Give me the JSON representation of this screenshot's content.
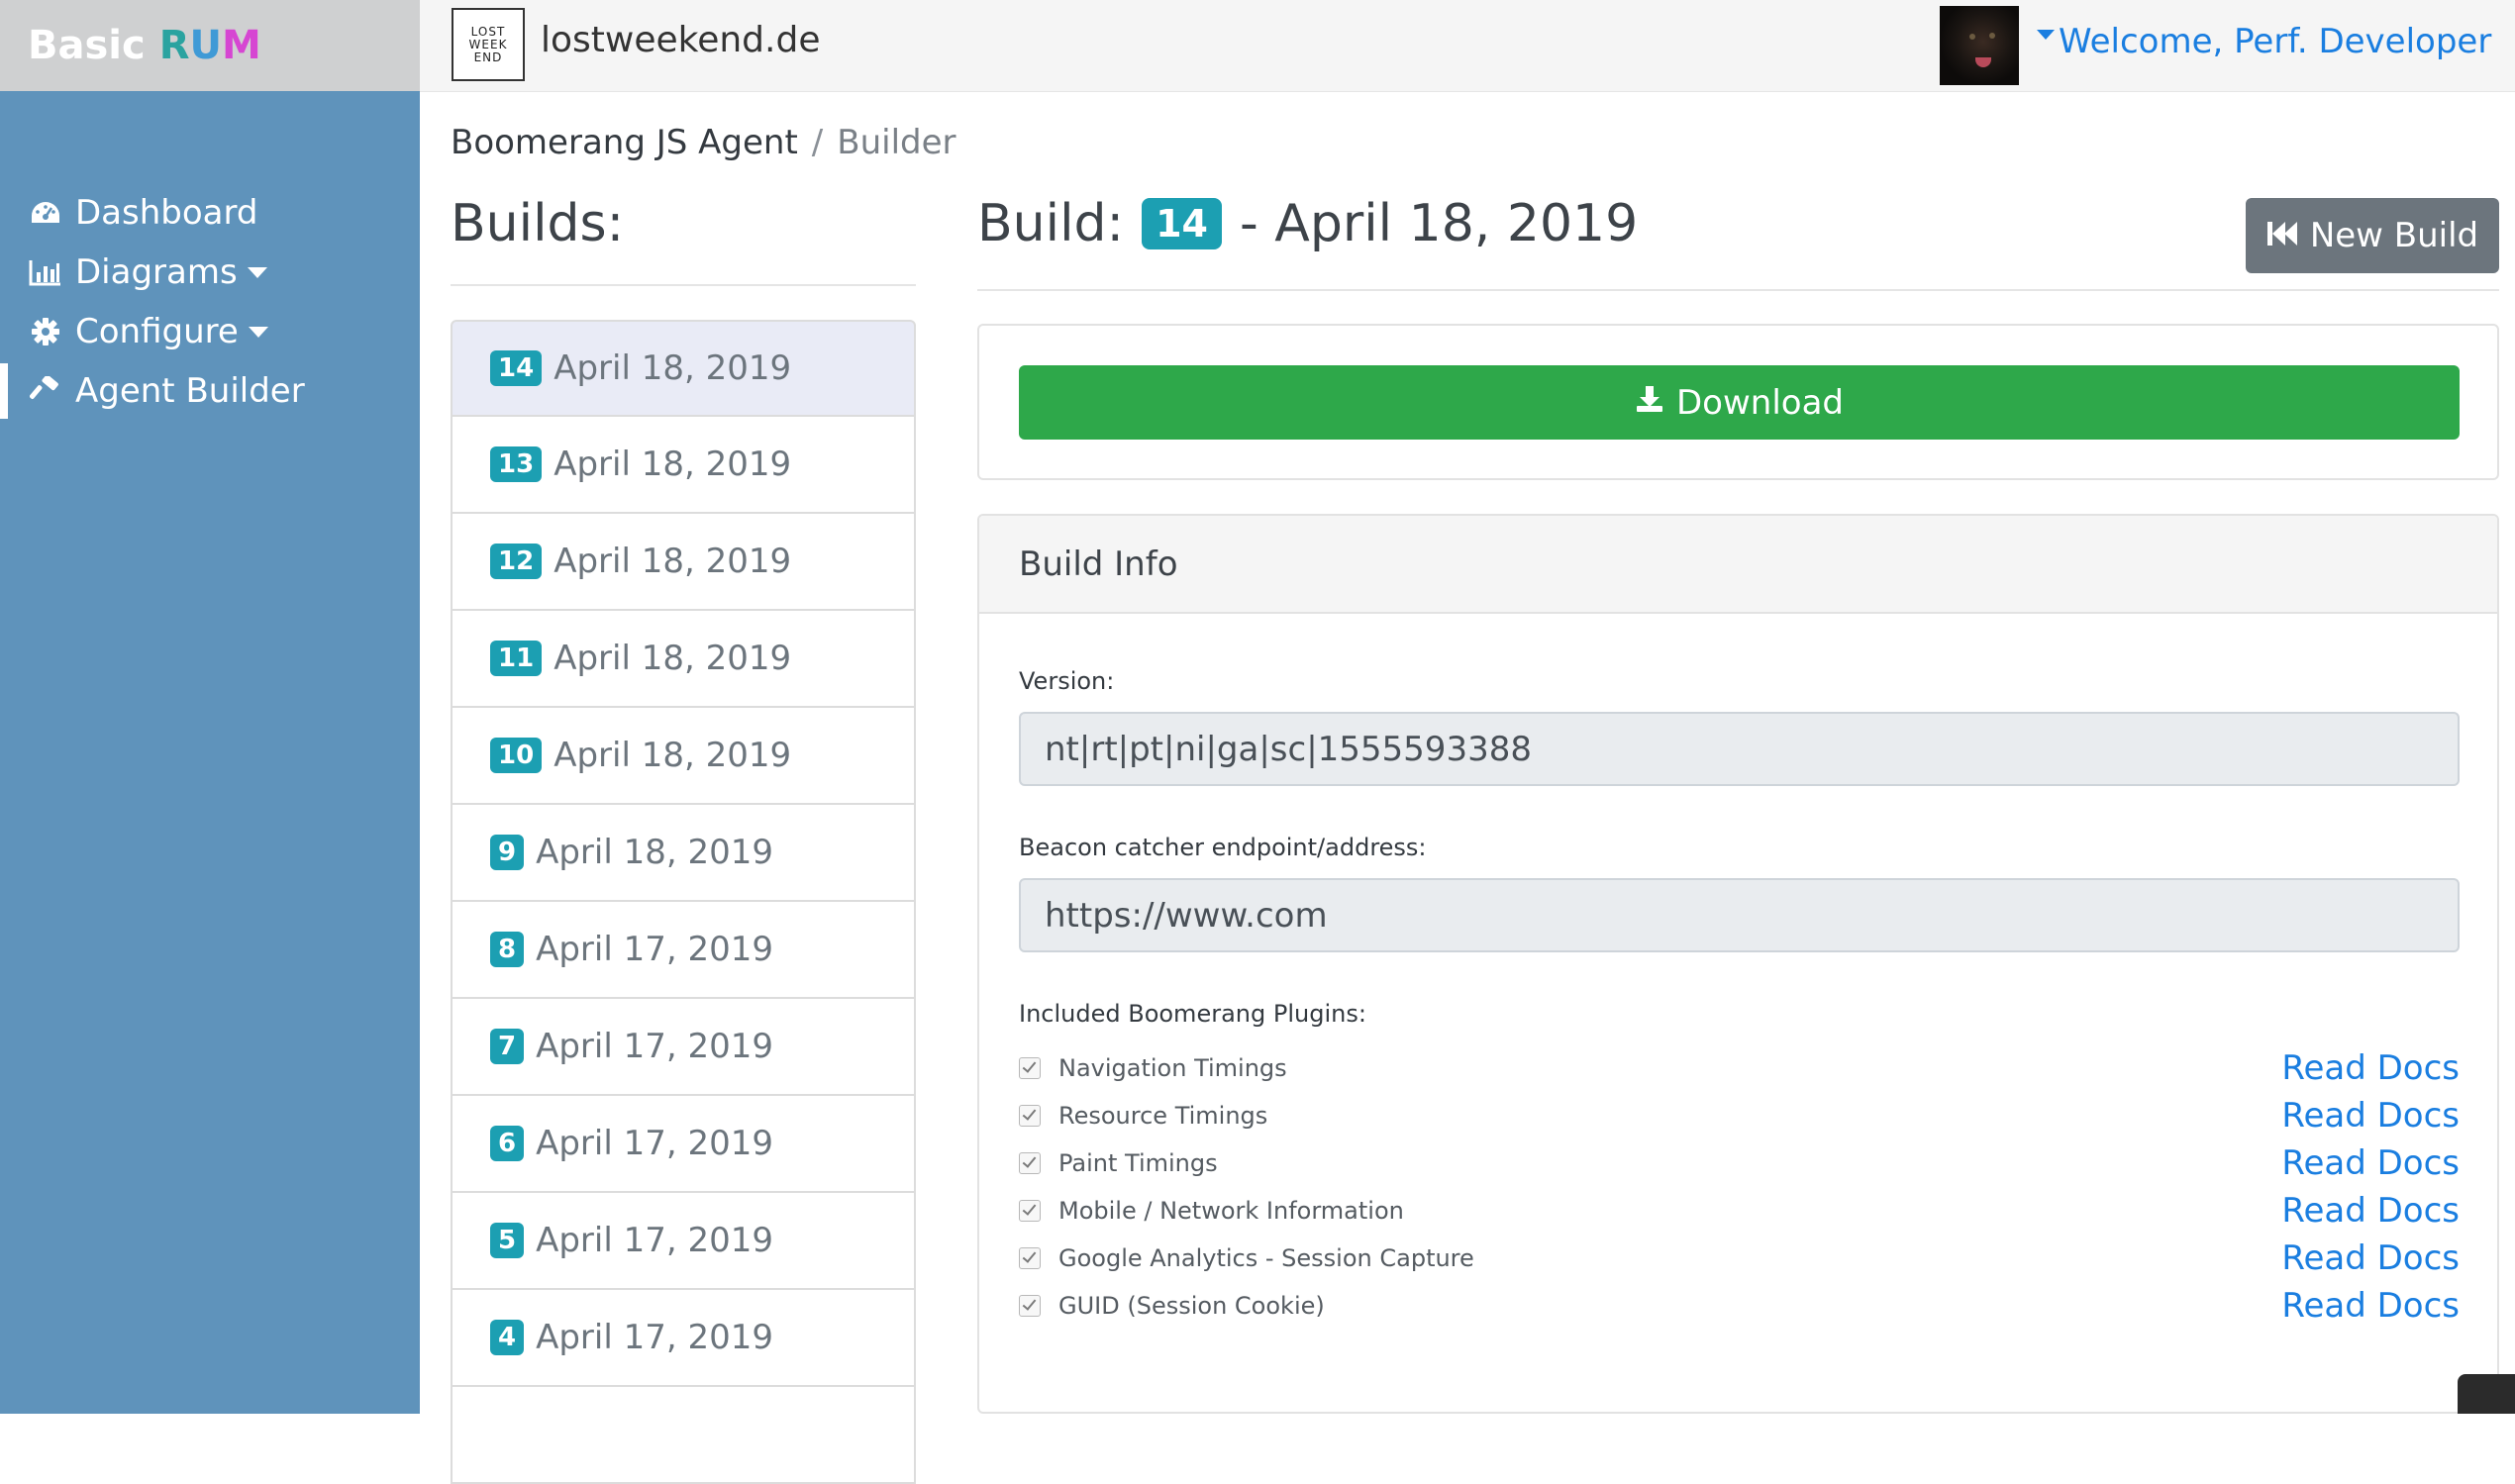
{
  "brand": {
    "word1": "Basic",
    "letter_r": "R",
    "letter_u": "U",
    "letter_m": "M"
  },
  "sidebar": {
    "items": [
      {
        "label": "Dashboard",
        "icon": "dashboard-icon"
      },
      {
        "label": "Diagrams",
        "icon": "bar-chart-icon"
      },
      {
        "label": "Configure",
        "icon": "gear-icon"
      },
      {
        "label": "Agent Builder",
        "icon": "hammer-icon"
      }
    ]
  },
  "topbar": {
    "logo_lines": [
      "LOST",
      "WEEK",
      "END"
    ],
    "site_name": "lostweekend.de",
    "welcome": "Welcome, Perf. Developer"
  },
  "breadcrumb": {
    "parent": "Boomerang JS Agent",
    "separator": "/",
    "current": "Builder"
  },
  "builds": {
    "title": "Builds:",
    "items": [
      {
        "num": "14",
        "date": "April 18, 2019"
      },
      {
        "num": "13",
        "date": "April 18, 2019"
      },
      {
        "num": "12",
        "date": "April 18, 2019"
      },
      {
        "num": "11",
        "date": "April 18, 2019"
      },
      {
        "num": "10",
        "date": "April 18, 2019"
      },
      {
        "num": "9",
        "date": "April 18, 2019"
      },
      {
        "num": "8",
        "date": "April 17, 2019"
      },
      {
        "num": "7",
        "date": "April 17, 2019"
      },
      {
        "num": "6",
        "date": "April 17, 2019"
      },
      {
        "num": "5",
        "date": "April 17, 2019"
      },
      {
        "num": "4",
        "date": "April 17, 2019"
      }
    ]
  },
  "detail": {
    "prefix": "Build:",
    "num": "14",
    "date_text": "- April 18, 2019",
    "new_build": "New Build",
    "download": "Download",
    "info_title": "Build Info",
    "version_label": "Version:",
    "version_value": "nt|rt|pt|ni|ga|sc|1555593388",
    "endpoint_label": "Beacon catcher endpoint/address:",
    "endpoint_value": "https://www.com",
    "plugins_label": "Included Boomerang Plugins:",
    "plugins": [
      {
        "name": "Navigation Timings",
        "docs": "Read Docs",
        "checked": true
      },
      {
        "name": "Resource Timings",
        "docs": "Read Docs",
        "checked": true
      },
      {
        "name": "Paint Timings",
        "docs": "Read Docs",
        "checked": true
      },
      {
        "name": "Mobile / Network Information",
        "docs": "Read Docs",
        "checked": true
      },
      {
        "name": "Google Analytics - Session Capture",
        "docs": "Read Docs",
        "checked": true
      },
      {
        "name": "GUID (Session Cookie)",
        "docs": "Read Docs",
        "checked": true
      }
    ]
  },
  "colors": {
    "sidebar": "#5f93bb",
    "badge": "#1c9fb2",
    "download": "#2ea84a",
    "link": "#1a7ee0",
    "secondary_button": "#6c757d"
  }
}
